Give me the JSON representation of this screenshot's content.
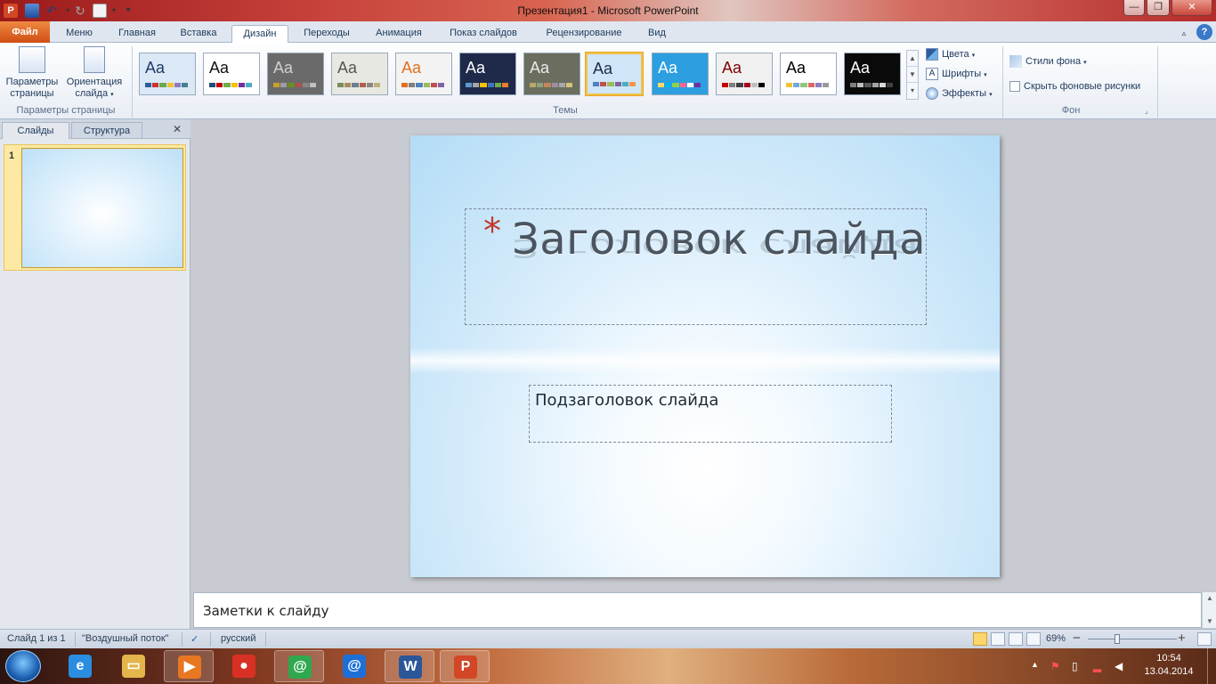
{
  "window": {
    "title": "Презентация1  -  Microsoft PowerPoint"
  },
  "tabs": {
    "file": "Файл",
    "items": [
      "Меню",
      "Главная",
      "Вставка",
      "Дизайн",
      "Переходы",
      "Анимация",
      "Показ слайдов",
      "Рецензирование",
      "Вид"
    ],
    "active": "Дизайн"
  },
  "ribbon": {
    "page_setup": {
      "page_params": "Параметры страницы",
      "orientation": "Ориентация слайда",
      "group": "Параметры страницы"
    },
    "themes": {
      "group": "Темы",
      "sample": "Aa",
      "items": [
        {
          "bg": "#dbe8f5",
          "fg": "#1f3a6b",
          "swatches": [
            "#2f5b9c",
            "#cc3333",
            "#6aa84f",
            "#f1c232",
            "#8e7cc3",
            "#45818e"
          ]
        },
        {
          "bg": "#ffffff",
          "fg": "#111111",
          "swatches": [
            "#1f4e79",
            "#c00000",
            "#70ad47",
            "#ffc000",
            "#7030a0",
            "#4bacc6"
          ]
        },
        {
          "bg": "#6a6a6a",
          "fg": "#d0d0d0",
          "swatches": [
            "#c9a227",
            "#9e9e9e",
            "#6b8e23",
            "#b05050",
            "#888888",
            "#c0c0c0"
          ]
        },
        {
          "bg": "#e8e8e2",
          "fg": "#555555",
          "swatches": [
            "#7a8c5a",
            "#a88d5c",
            "#6b7e94",
            "#b45f4a",
            "#888888",
            "#c0b080"
          ]
        },
        {
          "bg": "#f3f3f3",
          "fg": "#e07020",
          "swatches": [
            "#e07020",
            "#7f7f7f",
            "#4f81bd",
            "#9bbb59",
            "#c0504d",
            "#8064a2"
          ]
        },
        {
          "bg": "#1f2a4a",
          "fg": "#ffffff",
          "swatches": [
            "#5b9bd5",
            "#a5a5a5",
            "#ffc000",
            "#4472c4",
            "#70ad47",
            "#ed7d31"
          ]
        },
        {
          "bg": "#6b6e5e",
          "fg": "#eaeaea",
          "swatches": [
            "#b8a86a",
            "#8fa07a",
            "#c4855b",
            "#9d8caa",
            "#a7a7a7",
            "#d6c47a"
          ]
        },
        {
          "bg": "#cfe6f8",
          "fg": "#1f2a44",
          "swatches": [
            "#4f81bd",
            "#c0504d",
            "#9bbb59",
            "#8064a2",
            "#4bacc6",
            "#f79646"
          ]
        },
        {
          "bg": "#2d9fe0",
          "fg": "#ffffff",
          "swatches": [
            "#ffd966",
            "#00b0f0",
            "#92d050",
            "#ff6699",
            "#ffffff",
            "#7030a0"
          ]
        },
        {
          "bg": "#f0f0f0",
          "fg": "#7f0000",
          "swatches": [
            "#c00000",
            "#7f7f7f",
            "#404040",
            "#a50021",
            "#bfbfbf",
            "#000000"
          ]
        },
        {
          "bg": "#ffffff",
          "fg": "#000000",
          "swatches": [
            "#f1c232",
            "#6fa8dc",
            "#93c47d",
            "#e06666",
            "#8e7cc3",
            "#999999"
          ]
        },
        {
          "bg": "#0a0a0a",
          "fg": "#ffffff",
          "swatches": [
            "#7f7f7f",
            "#bfbfbf",
            "#595959",
            "#a5a5a5",
            "#d9d9d9",
            "#404040"
          ]
        }
      ],
      "selected_index": 7
    },
    "theme_options": {
      "colors": "Цвета",
      "fonts": "Шрифты",
      "effects": "Эффекты"
    },
    "background": {
      "styles": "Стили фона",
      "hide_graphics": "Скрыть фоновые рисунки",
      "hide_graphics_checked": false,
      "group": "Фон"
    }
  },
  "left_pane": {
    "tab_slides": "Слайды",
    "tab_outline": "Структура",
    "slide_number": "1"
  },
  "slide": {
    "title_bullet": "*",
    "title": "Заголовок слайда",
    "subtitle": "Подзаголовок слайда"
  },
  "notes": {
    "placeholder": "Заметки к слайду"
  },
  "status": {
    "slide_info": "Слайд 1 из 1",
    "theme": "\"Воздушный поток\"",
    "language": "русский",
    "zoom": "69%",
    "zoom_out": "−",
    "zoom_in": "+"
  },
  "taskbar": {
    "time": "10:54",
    "date": "13.04.2014",
    "apps": [
      {
        "name": "ie",
        "glyph": "e",
        "color": "#2a8ee0",
        "open": false
      },
      {
        "name": "explorer",
        "glyph": "▭",
        "color": "#e3b54a",
        "open": false
      },
      {
        "name": "media",
        "glyph": "▶",
        "color": "#e87722",
        "open": true
      },
      {
        "name": "chrome",
        "glyph": "●",
        "color": "#d93025",
        "open": false
      },
      {
        "name": "mail-agent",
        "glyph": "@",
        "color": "#2fa84f",
        "open": true
      },
      {
        "name": "mail-ru",
        "glyph": "@",
        "color": "#1d6fd8",
        "open": false
      },
      {
        "name": "word",
        "glyph": "W",
        "color": "#2b579a",
        "open": true
      },
      {
        "name": "powerpoint",
        "glyph": "P",
        "color": "#d24726",
        "open": true
      }
    ]
  }
}
